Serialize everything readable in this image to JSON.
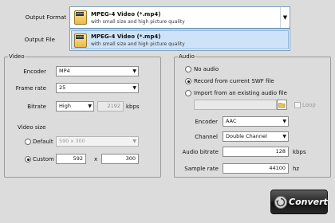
{
  "output_format": {
    "label": "Output Format",
    "selected_title": "MPEG-4 Video (*.mp4)",
    "selected_subtitle": "with small size and high picture quality",
    "icon_tag": "VIDEO"
  },
  "output_file": {
    "label": "Output File"
  },
  "dropdown": {
    "items": [
      {
        "title": "MPEG-4 Video (*.mp4)",
        "subtitle": "with small size and high picture quality",
        "icon_tag": "VIDEO"
      }
    ]
  },
  "video": {
    "group_title": "Video",
    "encoder_label": "Encoder",
    "encoder_value": "MP4",
    "frame_rate_label": "Frame rate",
    "frame_rate_value": "25",
    "bitrate_label": "Bitrate",
    "bitrate_value": "High",
    "bitrate_kbps": "2192",
    "kbps_unit": "kbps",
    "video_size_label": "Video size",
    "default_label": "Default",
    "default_value": "590 x 300",
    "custom_label": "Custom",
    "custom_width": "592",
    "x_sep": "x",
    "custom_height": "300",
    "selected_size_mode": "custom"
  },
  "audio": {
    "group_title": "Audio",
    "no_audio_label": "No audio",
    "record_label": "Record from current SWF file",
    "import_label": "Import from an existing audio file",
    "selected_option": "record",
    "loop_label": "Loop",
    "encoder_label": "Encoder",
    "encoder_value": "AAC",
    "channel_label": "Channel",
    "channel_value": "Double Channel",
    "bitrate_label": "Audio bitrate",
    "bitrate_value": "128",
    "kbps_unit": "kbps",
    "sample_rate_label": "Sample rate",
    "sample_rate_value": "44100",
    "hz_unit": "hz"
  },
  "convert_button": {
    "label": "Convert"
  },
  "icons": {
    "combo_arrow": "chevron-down-icon",
    "format": "video-file-icon",
    "browse": "folder-open-icon",
    "convert": "convert-icon"
  }
}
